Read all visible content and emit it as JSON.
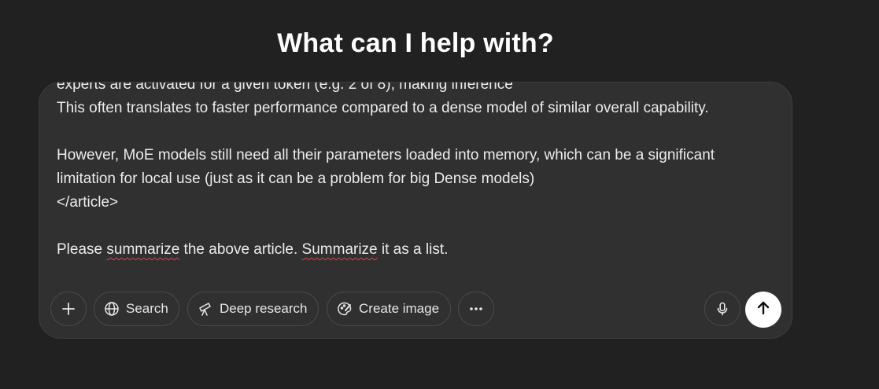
{
  "header": {
    "title": "What can I help with?"
  },
  "prompt": {
    "lines": [
      "experts are activated for a given token (e.g. 2 of 8), making inference",
      "This often translates to faster performance compared to a dense model of similar overall capability.",
      "",
      "However, MoE models still need all their parameters loaded into memory, which can be a significant",
      "limitation for local use (just as it can be a problem for big Dense models)",
      "</article>",
      "",
      "Please summarize the above article. Summarize it as a list."
    ],
    "last_line_parts": [
      "Please ",
      "summarize",
      " the above article. ",
      "Summarize",
      " it as a list."
    ]
  },
  "toolbar": {
    "add_icon": "plus-icon",
    "search_label": "Search",
    "search_icon": "globe-icon",
    "deep_research_label": "Deep research",
    "deep_research_icon": "telescope-icon",
    "create_image_label": "Create image",
    "create_image_icon": "palette-icon",
    "more_icon": "ellipsis-icon",
    "mic_icon": "microphone-icon",
    "send_icon": "arrow-up-icon"
  },
  "colors": {
    "background": "#212121",
    "composer": "#303030",
    "text": "#ececec",
    "send_button": "#ffffff",
    "spellcheck": "#d84848"
  }
}
